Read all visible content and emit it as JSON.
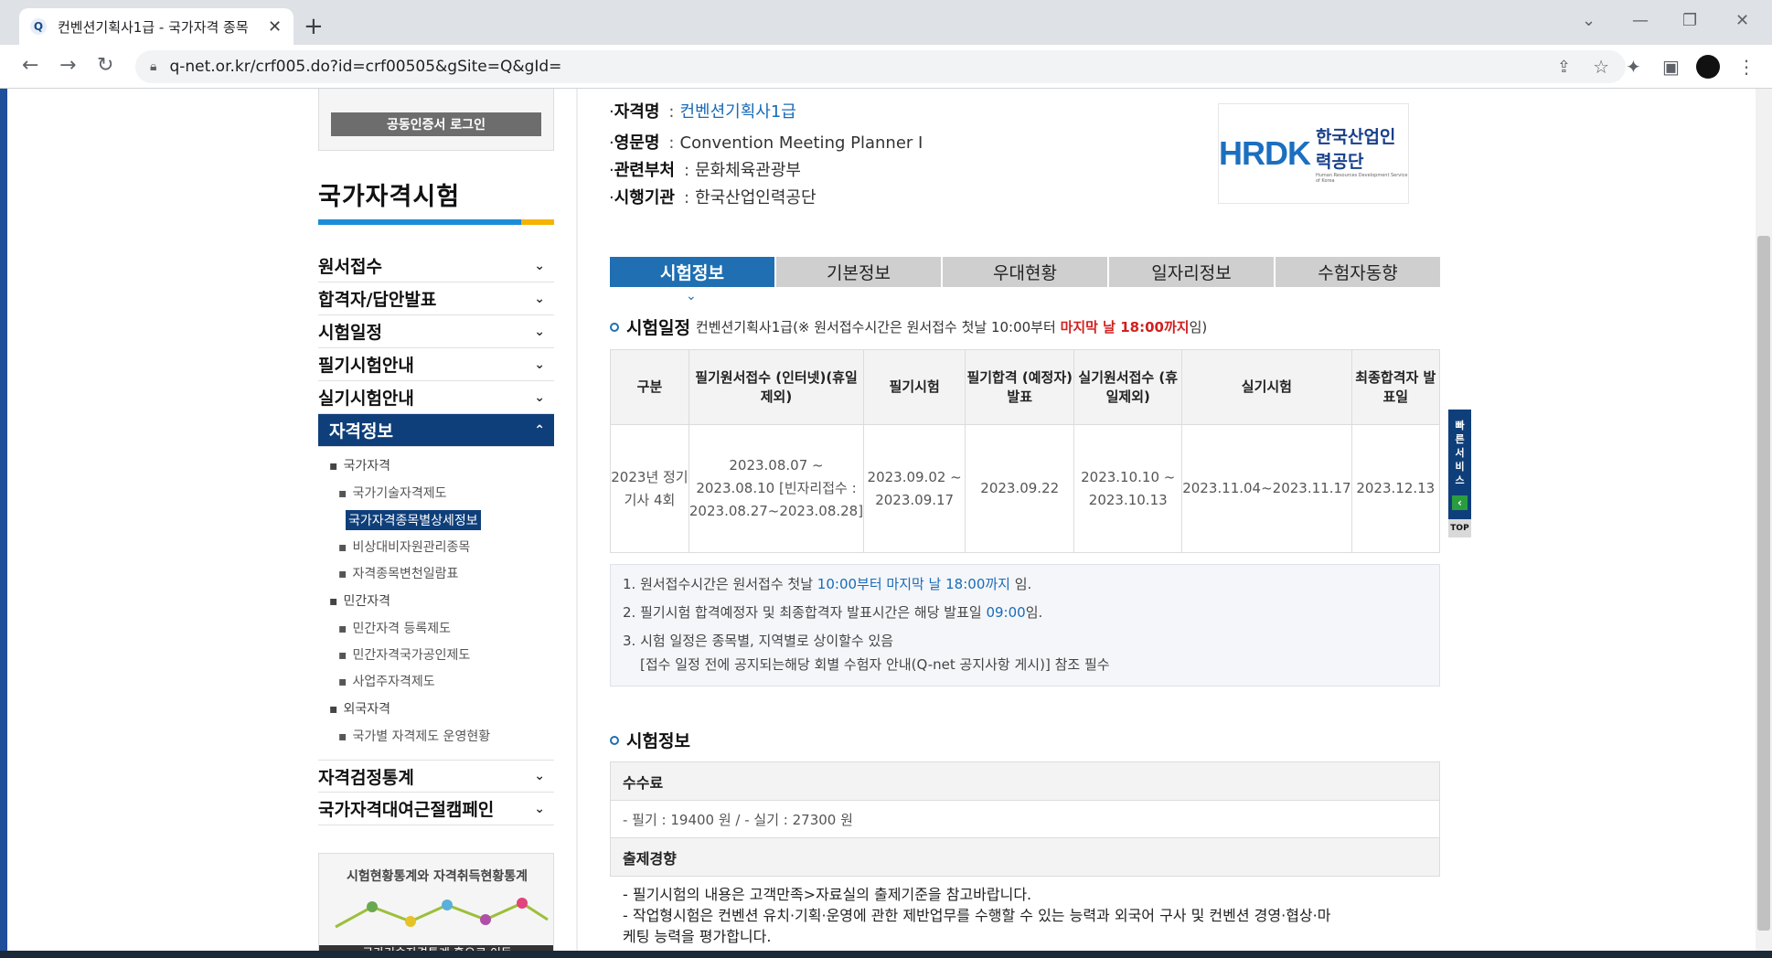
{
  "browser": {
    "tab_title": "컨벤션기획사1급 - 국가자격 종목",
    "favicon_letter": "Q",
    "url": "q-net.or.kr/crf005.do?id=crf00505&gSite=Q&gId=",
    "icons": [
      "back-icon",
      "forward-icon",
      "reload-icon",
      "lock-icon",
      "share-icon",
      "star-icon",
      "extensions-icon",
      "sidepanel-icon",
      "profile-icon",
      "menu-icon"
    ]
  },
  "sidebar": {
    "login_button": "공동인증서 로그인",
    "title": "국가자격시험",
    "menu": [
      {
        "label": "원서접수"
      },
      {
        "label": "합격자/답안발표"
      },
      {
        "label": "시험일정"
      },
      {
        "label": "필기시험안내"
      },
      {
        "label": "실기시험안내"
      },
      {
        "label": "자격정보"
      }
    ],
    "submenu": {
      "national": "국가자격",
      "national_items": [
        "국가기술자격제도",
        "국가자격종목별상세정보",
        "비상대비자원관리종목",
        "자격종목변천일람표"
      ],
      "private": "민간자격",
      "private_items": [
        "민간자격 등록제도",
        "민간자격국가공인제도",
        "사업주자격제도"
      ],
      "foreign": "외국자격",
      "foreign_items": [
        "국가별 자격제도 운영현황"
      ]
    },
    "menu_bottom": [
      {
        "label": "자격검정통계"
      },
      {
        "label": "국가자격대여근절캠페인"
      }
    ],
    "banner_title": "시험현황통계와 자격취득현황통계",
    "banner_link": "국가기술자격통계 홈으로 이동"
  },
  "qualification": {
    "name_label": "자격명",
    "name": "컨벤션기획사1급",
    "english_label": "영문명",
    "english": "Convention Meeting Planner Ⅰ",
    "ministry_label": "관련부처",
    "ministry": "문화체육관광부",
    "agency_label": "시행기관",
    "agency": "한국산업인력공단",
    "logo_mark": "HRDK",
    "logo_ko": "한국산업인력공단",
    "logo_en": "Human Resources Development Service of Korea"
  },
  "tabs": [
    "시험정보",
    "기본정보",
    "우대현황",
    "일자리정보",
    "수험자동향"
  ],
  "schedule": {
    "heading": "시험일정",
    "sub_prefix": "컨벤션기획사1급(※ 원서접수시간은 원서접수 첫날 10:00부터 ",
    "sub_red": "마지막 날 18:00까지",
    "sub_suffix": "임)",
    "columns": [
      "구분",
      "필기원서접수 (인터넷)(휴일 제외)",
      "필기시험",
      "필기합격 (예정자)발표",
      "실기원서접수 (휴일제외)",
      "실기시험",
      "최종합격자 발표일"
    ],
    "row": {
      "category": "2023년 정기 기사 4회",
      "written_apply": "2023.08.07 ~ 2023.08.10 [빈자리접수 : 2023.08.27~2023.08.28]",
      "written_exam": "2023.09.02 ~ 2023.09.17",
      "written_pass": "2023.09.22",
      "practical_apply": "2023.10.10 ~ 2023.10.13",
      "practical_exam": "2023.11.04~2023.11.17",
      "final_pass": "2023.12.13"
    }
  },
  "notes": {
    "n1_a": "1. 원서접수시간은 원서접수 첫날 ",
    "n1_blue": "10:00부터 마지막 날 18:00까지",
    "n1_b": " 임.",
    "n2_a": "2. 필기시험 합격예정자 및 최종합격자 발표시간은 해당 발표일 ",
    "n2_blue": "09:00",
    "n2_b": "임.",
    "n3": "3. 시험 일정은 종목별, 지역별로 상이할수 있음",
    "n3_sub": "[접수 일정 전에 공지되는해당 회별 수험자 안내(Q-net 공지사항 게시)] 참조 필수"
  },
  "exam_info": {
    "heading": "시험정보",
    "fee_label": "수수료",
    "fee_value": "- 필기 : 19400 원 / - 실기 : 27300 원",
    "trend_label": "출제경향",
    "trend_1": "- 필기시험의 내용은 고객만족>자료실의 출제기준을 참고바랍니다.",
    "trend_2": "- 작업형시험은 컨벤션 유치·기획·운영에 관한 제반업무를 수행할 수 있는 능력과 외국어 구사 및 컨벤션 경영·협상·마",
    "trend_3": "케팅 능력을 평가합니다."
  },
  "quick": {
    "label_chars": [
      "빠",
      "른",
      "서",
      "비",
      "스"
    ],
    "top": "TOP"
  },
  "colors": {
    "accent_blue": "#1f6fb2",
    "navy": "#0f3f7a",
    "red": "#d21f1f"
  }
}
